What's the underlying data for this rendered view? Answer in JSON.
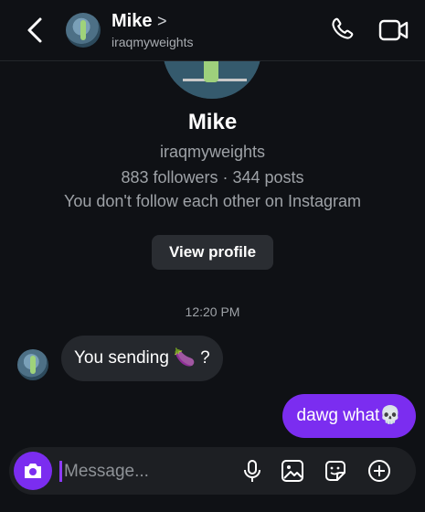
{
  "header": {
    "name": "Mike",
    "chevron": ">",
    "username": "iraqmyweights",
    "icons": {
      "back": "chevron-left-icon",
      "call": "phone-icon",
      "video": "video-camera-icon"
    }
  },
  "profile": {
    "name": "Mike",
    "username": "iraqmyweights",
    "stats": "883 followers · 344 posts",
    "follow_status": "You don't follow each other on Instagram",
    "view_button": "View profile"
  },
  "thread": {
    "timestamp": "12:20 PM",
    "messages": [
      {
        "direction": "incoming",
        "text": "You sending 🍆 ?"
      },
      {
        "direction": "outgoing",
        "text": "dawg what💀"
      }
    ]
  },
  "composer": {
    "placeholder": "Message...",
    "icons": [
      "camera-icon",
      "microphone-icon",
      "gallery-icon",
      "sticker-icon",
      "plus-icon"
    ]
  },
  "colors": {
    "background": "#0f1115",
    "accent": "#7b2df0",
    "incoming_bubble": "#25282d",
    "secondary_text": "#9ea2a7"
  }
}
